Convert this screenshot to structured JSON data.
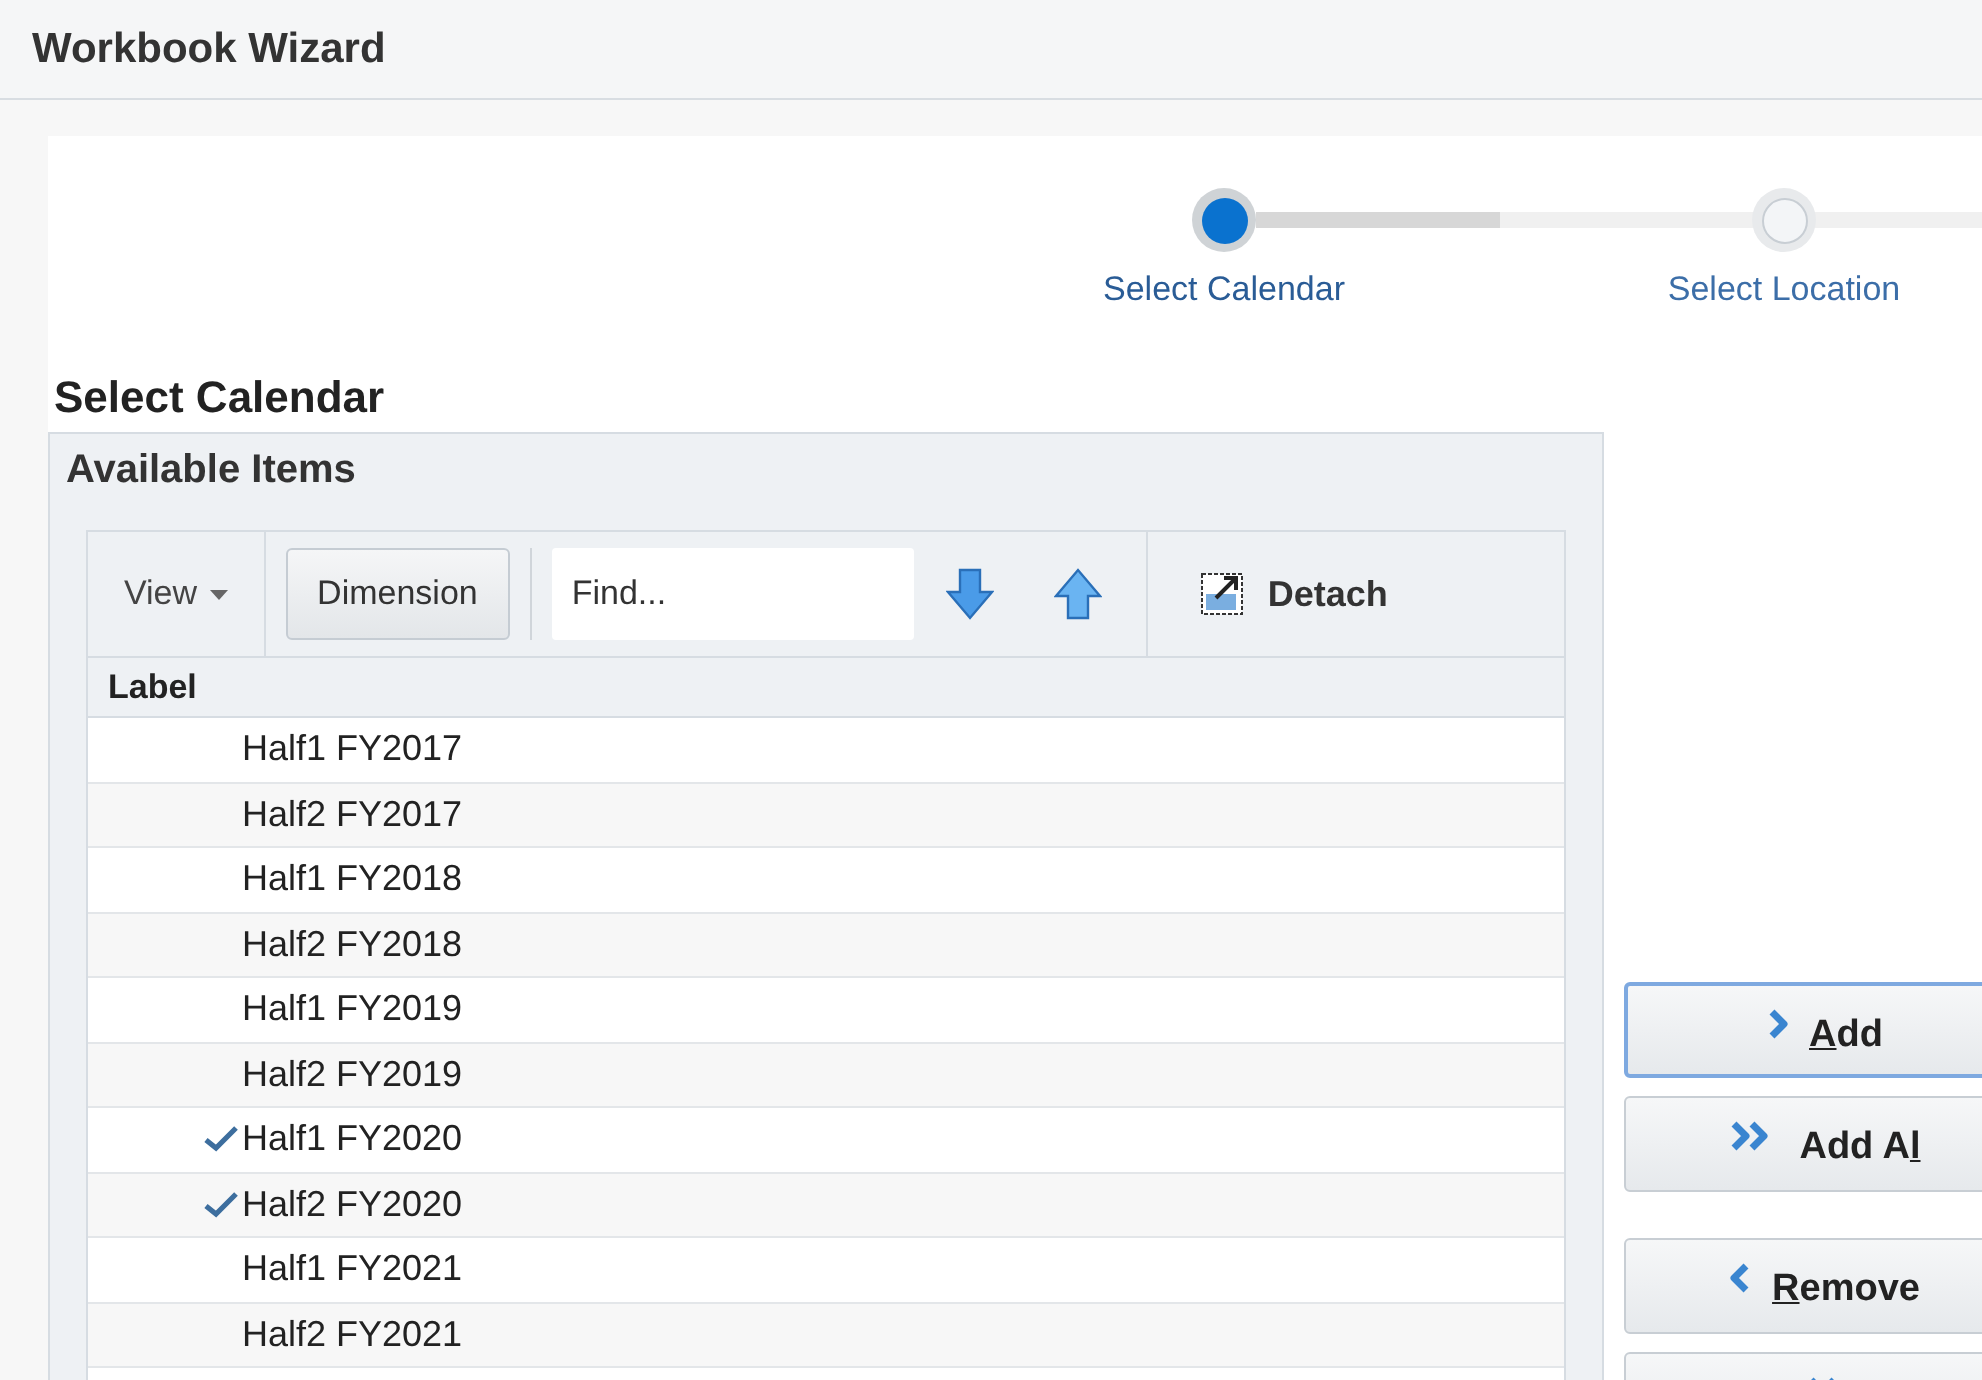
{
  "window": {
    "title": "Workbook Wizard"
  },
  "steps": [
    {
      "label": "Select Calendar",
      "selected": true
    },
    {
      "label": "Select Location",
      "selected": false
    }
  ],
  "section_title": "Select Calendar",
  "available_items": {
    "title": "Available Items",
    "toolbar": {
      "view": "View",
      "dimension": "Dimension",
      "find_placeholder": "Find...",
      "detach": "Detach"
    },
    "column": "Label",
    "rows": [
      {
        "label": "Half1 FY2017",
        "checked": false
      },
      {
        "label": "Half2 FY2017",
        "checked": false
      },
      {
        "label": "Half1 FY2018",
        "checked": false
      },
      {
        "label": "Half2 FY2018",
        "checked": false
      },
      {
        "label": "Half1 FY2019",
        "checked": false
      },
      {
        "label": "Half2 FY2019",
        "checked": false
      },
      {
        "label": "Half1 FY2020",
        "checked": true
      },
      {
        "label": "Half2 FY2020",
        "checked": true
      },
      {
        "label": "Half1 FY2021",
        "checked": false
      },
      {
        "label": "Half2 FY2021",
        "checked": false
      }
    ]
  },
  "buttons": [
    {
      "kind": "add",
      "key": "A",
      "after": "dd",
      "focused": true
    },
    {
      "kind": "add_all",
      "before": "Add A",
      "key": "l",
      "focused": false
    },
    {
      "kind": "remove",
      "key": "R",
      "after": "emove",
      "focused": false
    },
    {
      "kind": "remove_all",
      "focused": false
    }
  ]
}
